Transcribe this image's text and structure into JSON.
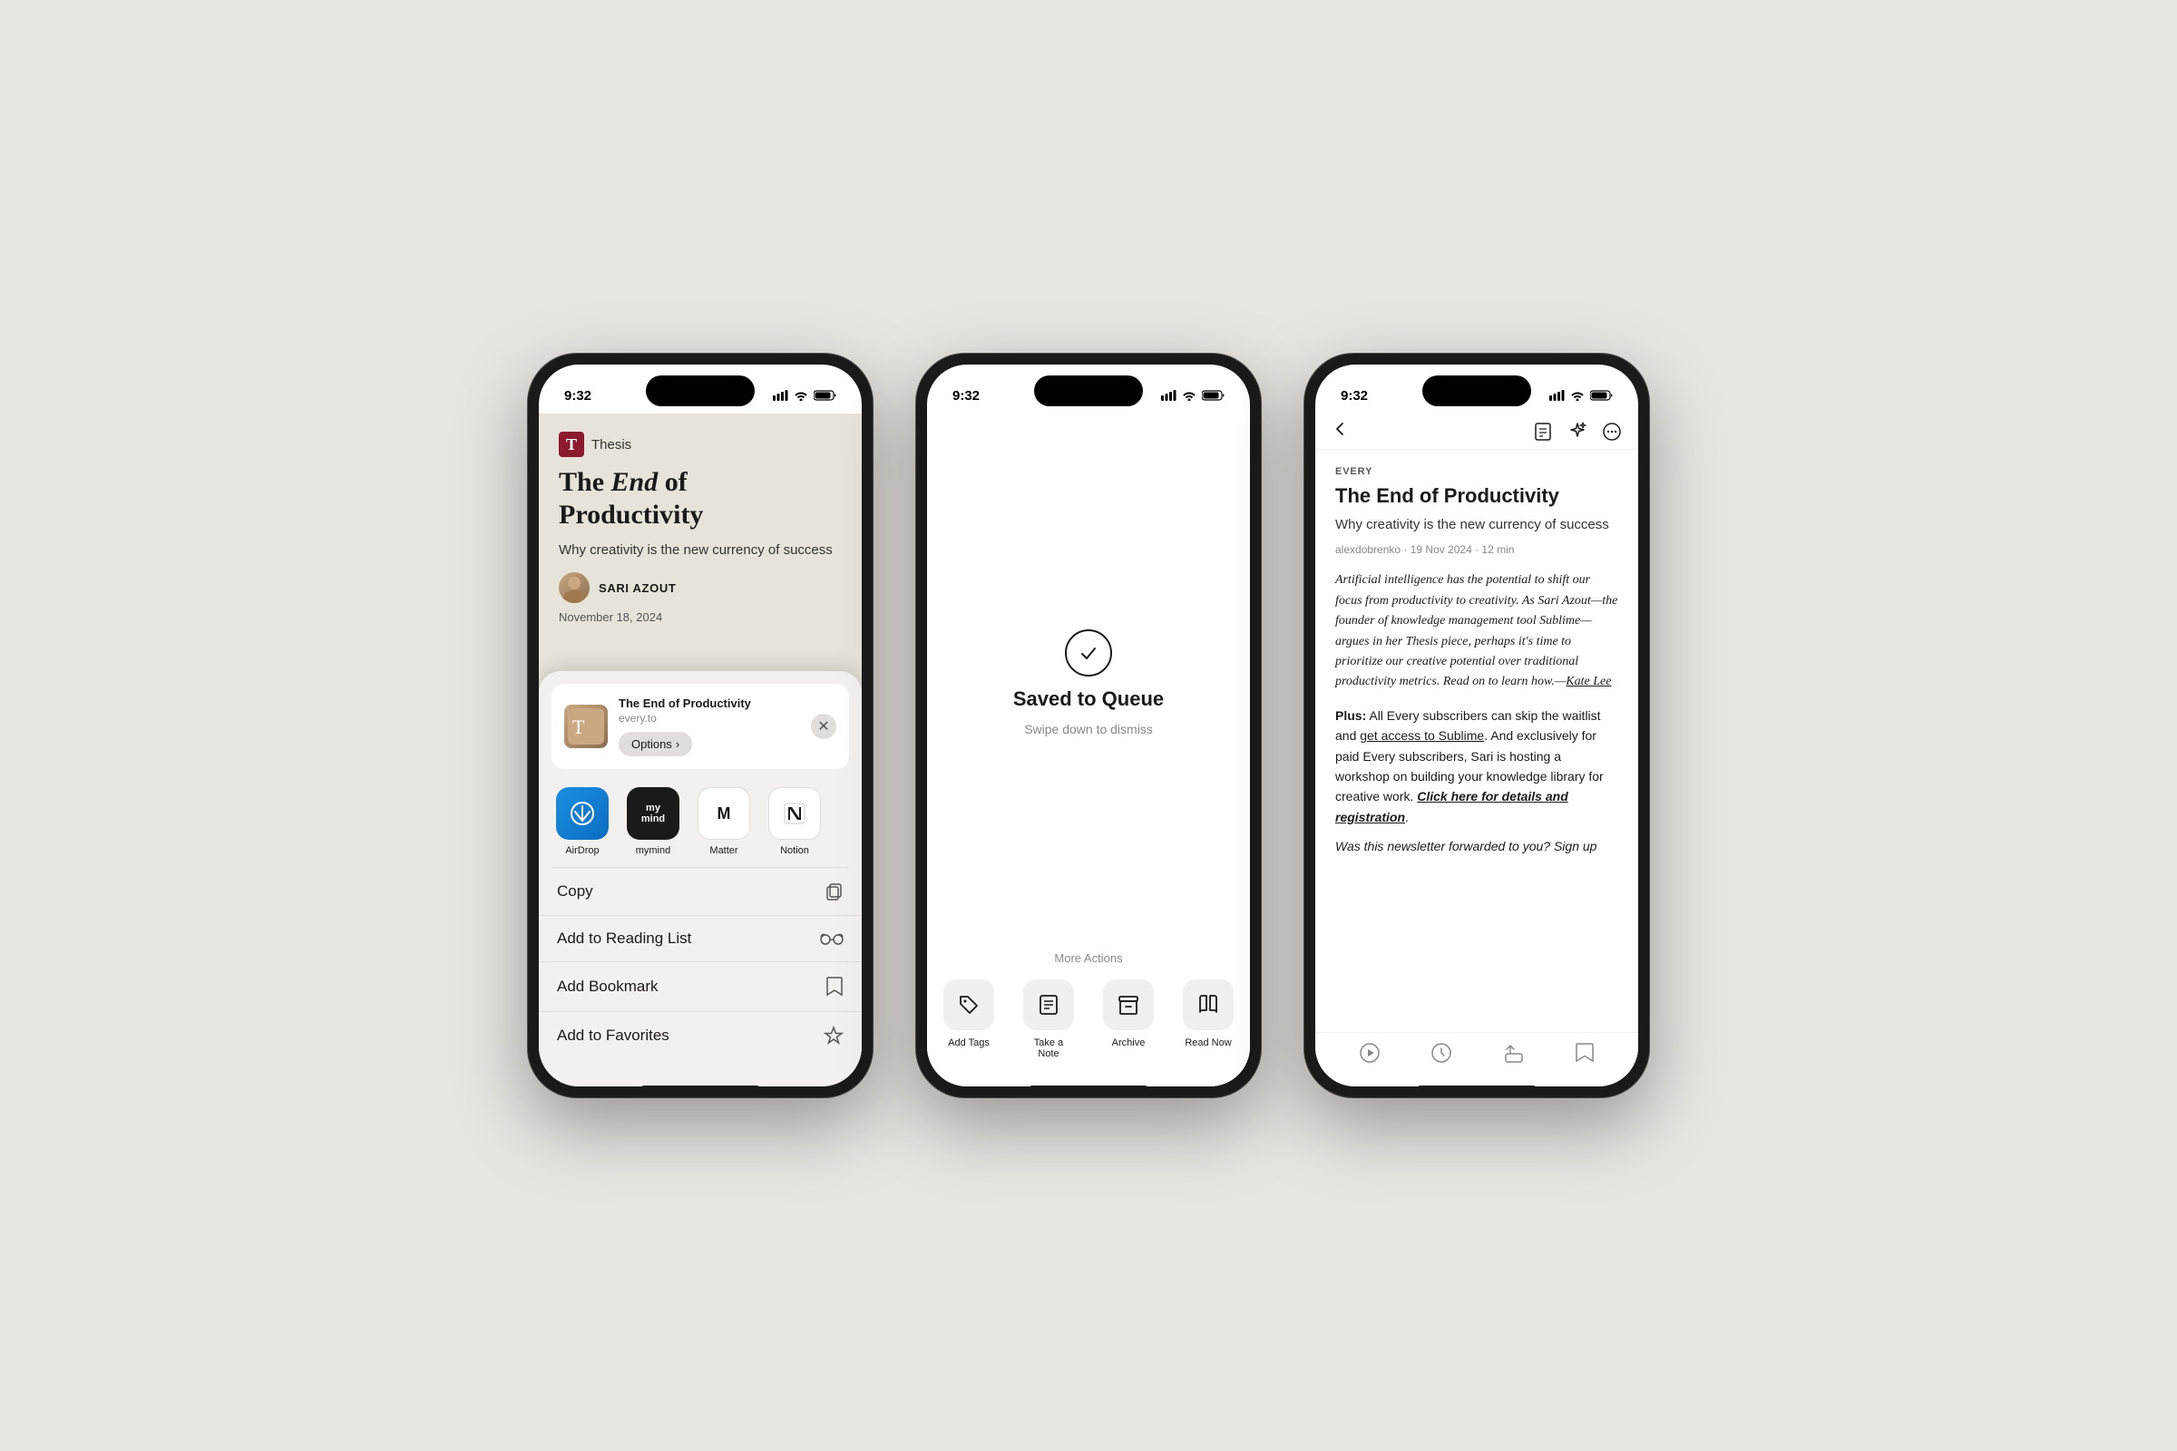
{
  "scene": {
    "bg_color": "#e8e6e1"
  },
  "phone1": {
    "status_time": "9:32",
    "thesis_label": "Thesis",
    "article_title": "The End of\nProductivity",
    "article_subtitle": "Why creativity is the new currency of success",
    "author_name": "SARI AZOUT",
    "article_date": "November 18, 2024",
    "share_card_title": "The End of Productivity",
    "share_card_domain": "every.to",
    "options_btn": "Options",
    "apps": [
      {
        "name": "AirDrop",
        "type": "airdrop"
      },
      {
        "name": "mymind",
        "type": "mymind"
      },
      {
        "name": "Matter",
        "type": "matter"
      },
      {
        "name": "Notion",
        "type": "notion"
      }
    ],
    "menu_items": [
      {
        "label": "Copy",
        "icon": "copy"
      },
      {
        "label": "Add to Reading List",
        "icon": "glasses"
      },
      {
        "label": "Add Bookmark",
        "icon": "bookmark"
      },
      {
        "label": "Add to Favorites",
        "icon": "star"
      }
    ]
  },
  "phone2": {
    "status_time": "9:32",
    "saved_title": "Saved to Queue",
    "saved_sub": "Swipe down to dismiss",
    "more_actions_label": "More Actions",
    "actions": [
      {
        "label": "Add Tags",
        "icon": "tag"
      },
      {
        "label": "Take a Note",
        "icon": "note"
      },
      {
        "label": "Archive",
        "icon": "archive"
      },
      {
        "label": "Read Now",
        "icon": "book"
      }
    ]
  },
  "phone3": {
    "status_time": "9:32",
    "source": "EVERY",
    "title": "The End of Productivity",
    "subtitle": "Why creativity is the new currency of success",
    "meta": "alexdobrenko · 19 Nov 2024 · 12 min",
    "excerpt": "Artificial intelligence has the potential to shift our focus from productivity to creativity. As Sari Azout—the founder of knowledge management tool Sublime—argues in her Thesis piece, perhaps it's time to prioritize our creative potential over traditional productivity metrics. Read on to learn how.—Kate Lee",
    "plus_text": "Plus: All Every subscribers can skip the waitlist and get access to Sublime. And exclusively for paid Every subscribers, Sari is hosting a workshop on building your knowledge library for creative work. Click here for details and registration.",
    "more_text": "Was this newsletter forwarded to you? Sign up"
  }
}
